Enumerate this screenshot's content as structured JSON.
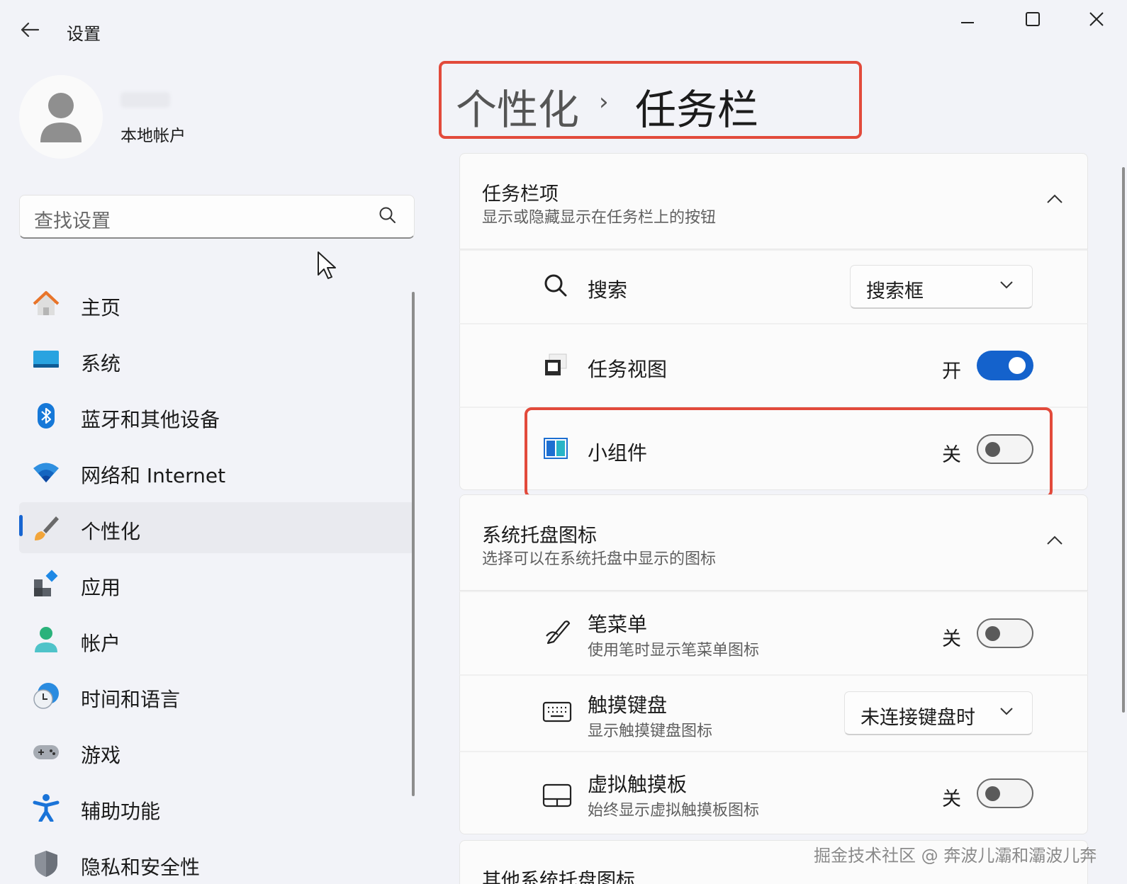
{
  "window": {
    "title": "设置",
    "back_icon": "arrow-left-icon",
    "controls": [
      "minimize-icon",
      "maximize-icon",
      "close-icon"
    ]
  },
  "profile": {
    "account_type": "本地帐户"
  },
  "search": {
    "placeholder": "查找设置"
  },
  "nav": {
    "items": [
      {
        "label": "主页",
        "icon": "home-icon"
      },
      {
        "label": "系统",
        "icon": "system-icon"
      },
      {
        "label": "蓝牙和其他设备",
        "icon": "bluetooth-icon"
      },
      {
        "label": "网络和 Internet",
        "icon": "wifi-icon"
      },
      {
        "label": "个性化",
        "icon": "brush-icon",
        "active": true
      },
      {
        "label": "应用",
        "icon": "apps-icon"
      },
      {
        "label": "帐户",
        "icon": "account-icon"
      },
      {
        "label": "时间和语言",
        "icon": "time-language-icon"
      },
      {
        "label": "游戏",
        "icon": "gamepad-icon"
      },
      {
        "label": "辅助功能",
        "icon": "accessibility-icon"
      },
      {
        "label": "隐私和安全性",
        "icon": "shield-icon"
      }
    ]
  },
  "breadcrumb": {
    "parent": "个性化",
    "separator": "›",
    "current": "任务栏"
  },
  "taskbar_items": {
    "title": "任务栏项",
    "subtitle": "显示或隐藏显示在任务栏上的按钮",
    "rows": {
      "search": {
        "label": "搜索",
        "value": "搜索框"
      },
      "task_view": {
        "label": "任务视图",
        "state": "开"
      },
      "widgets": {
        "label": "小组件",
        "state": "关"
      }
    }
  },
  "tray_icons": {
    "title": "系统托盘图标",
    "subtitle": "选择可以在系统托盘中显示的图标",
    "rows": {
      "pen": {
        "label": "笔菜单",
        "sub": "使用笔时显示笔菜单图标",
        "state": "关"
      },
      "touch_keyboard": {
        "label": "触摸键盘",
        "sub": "显示触摸键盘图标",
        "value": "未连接键盘时"
      },
      "touchpad": {
        "label": "虚拟触摸板",
        "sub": "始终显示虚拟触摸板图标",
        "state": "关"
      }
    }
  },
  "other_tray": {
    "title": "其他系统托盘图标"
  },
  "watermark": "掘金技术社区 @ 奔波儿灞和灞波儿奔",
  "colors": {
    "accent": "#1462cc",
    "highlight": "#e24a3b"
  }
}
